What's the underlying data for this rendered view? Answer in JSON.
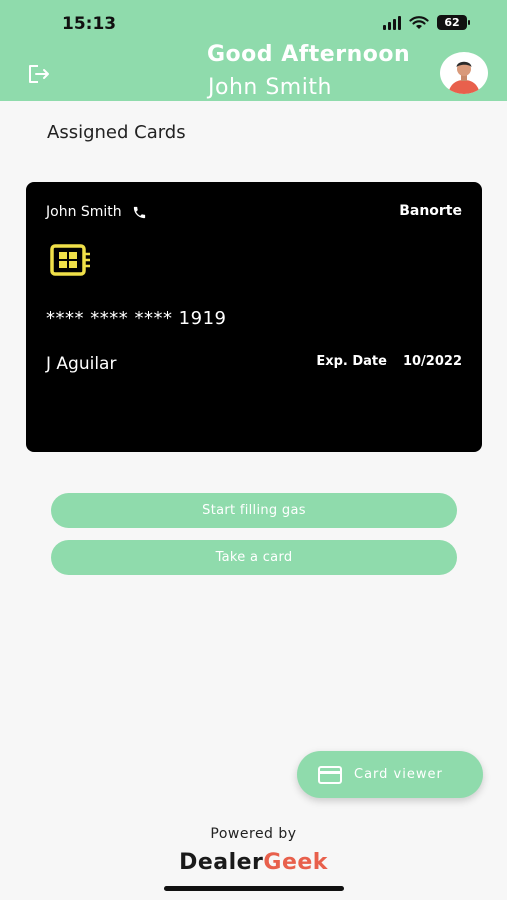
{
  "status_bar": {
    "time": "15:13",
    "battery": "62",
    "icons": [
      "signal-icon",
      "wifi-icon",
      "battery-icon"
    ]
  },
  "header": {
    "greeting": "Good Afternoon",
    "user_name": "John Smith",
    "logout_icon": "logout-icon",
    "avatar_icon": "avatar",
    "background_color": "#8fdbac"
  },
  "section_title": "Assigned Cards",
  "card": {
    "holder": "John Smith",
    "phone_icon": "phone-icon",
    "bank": "Banorte",
    "chip_icon": "chip-icon",
    "number": "**** **** **** 1919",
    "name": "J Aguilar",
    "exp_label": "Exp. Date",
    "exp_value": "10/2022",
    "background_color": "#000000"
  },
  "buttons": {
    "start_filling": "Start filling gas",
    "take_card": "Take a card"
  },
  "fab": {
    "label": "Card viewer",
    "icon": "credit-card-icon"
  },
  "footer": {
    "powered_by": "Powered by",
    "brand_part1": "Dealer",
    "brand_part2": "Geek",
    "brand_part1_color": "#1a1a1a",
    "brand_part2_color": "#e8604c"
  }
}
